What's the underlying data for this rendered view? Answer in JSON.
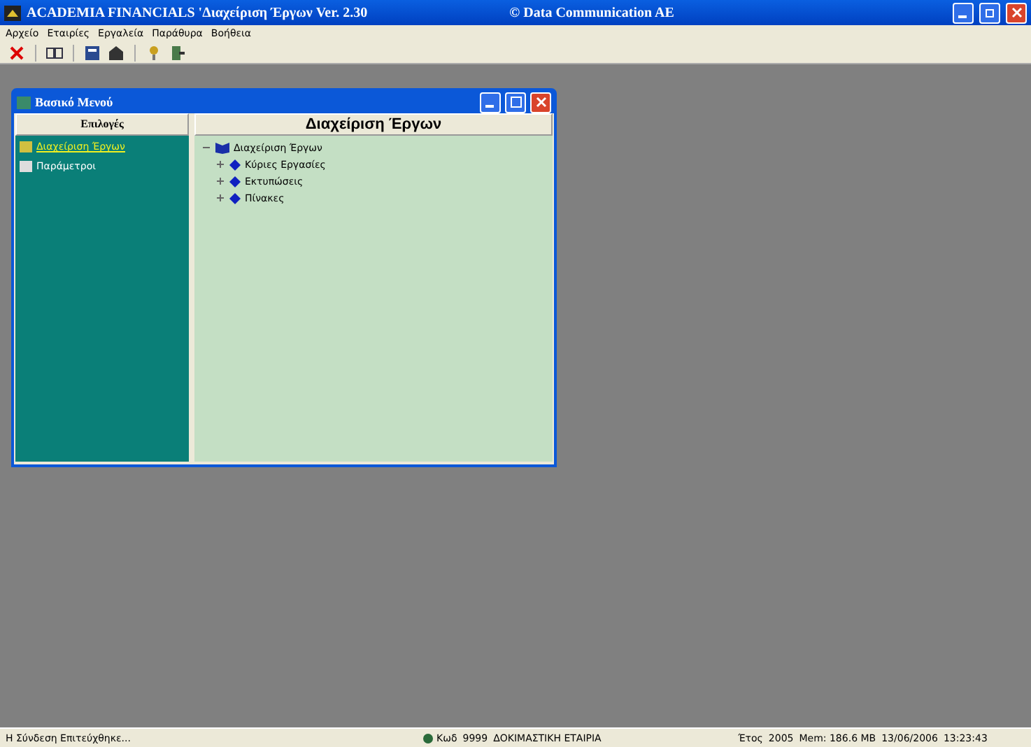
{
  "window": {
    "title": "ACADEMIA FINANCIALS 'Διαχείριση Έργων Ver. 2.30",
    "copyright": "© Data Communication AE"
  },
  "menu": [
    "Αρχείο",
    "Εταιρίες",
    "Εργαλεία",
    "Παράθυρα",
    "Βοήθεια"
  ],
  "child_window": {
    "title": "Βασικό Μενού",
    "left_header": "Επιλογές",
    "right_header": "Διαχείριση Έργων",
    "options": [
      {
        "label": "Διαχείριση Έργων",
        "selected": true
      },
      {
        "label": "Παράμετροι",
        "selected": false
      }
    ],
    "tree": [
      {
        "label": "Διαχείριση Έργων",
        "expanded": true,
        "children": [
          {
            "label": "Κύριες Εργασίες",
            "expanded": false
          },
          {
            "label": "Εκτυπώσεις",
            "expanded": false
          },
          {
            "label": "Πίνακες",
            "expanded": false
          }
        ]
      }
    ]
  },
  "status_bar": [
    "Η Σύνδεση Επιτεύχθηκε...",
    "Κωδ",
    "9999",
    "ΔΟΚΙΜΑΣΤΙΚΗ ΕΤΑΙΡΙΑ",
    "Έτος",
    "2005",
    "Mem: 186.6 MB",
    "13/06/2006",
    "13:23:43"
  ]
}
